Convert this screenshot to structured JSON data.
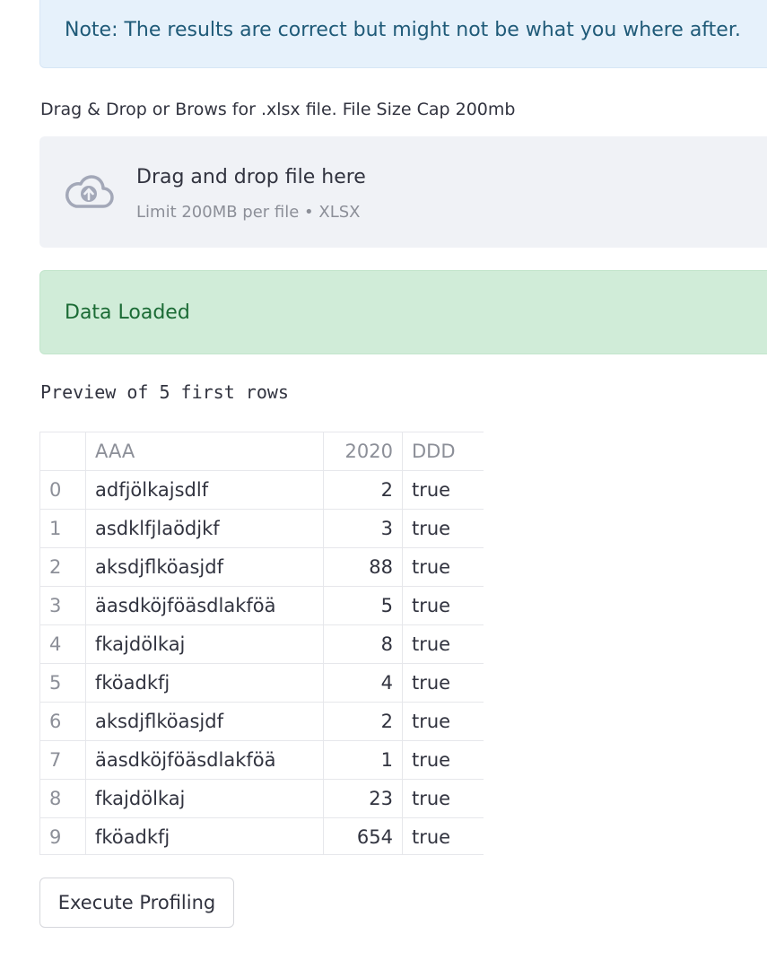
{
  "info": {
    "text": "Note: The results are correct but might not be what you where after."
  },
  "uploader": {
    "label": "Drag & Drop or Brows for .xlsx file. File Size Cap 200mb",
    "icon": "cloud-upload-icon",
    "title": "Drag and drop file here",
    "subtitle": "Limit 200MB per file • XLSX"
  },
  "success": {
    "text": "Data Loaded"
  },
  "preview": {
    "caption": "Preview of 5 first rows",
    "columns": [
      "",
      "AAA",
      "2020",
      "DDD"
    ],
    "rows": [
      [
        "0",
        "adfjölkajsdlf",
        "2",
        "true"
      ],
      [
        "1",
        "asdklfjlaödjkf",
        "3",
        "true"
      ],
      [
        "2",
        "aksdjflköasjdf",
        "88",
        "true"
      ],
      [
        "3",
        "äasdköjföäsdlakföä",
        "5",
        "true"
      ],
      [
        "4",
        "fkajdölkaj",
        "8",
        "true"
      ],
      [
        "5",
        "fköadkfj",
        "4",
        "true"
      ],
      [
        "6",
        "aksdjflköasjdf",
        "2",
        "true"
      ],
      [
        "7",
        "äasdköjföäsdlakföä",
        "1",
        "true"
      ],
      [
        "8",
        "fkajdölkaj",
        "23",
        "true"
      ],
      [
        "9",
        "fköadkfj",
        "654",
        "true"
      ]
    ]
  },
  "actions": {
    "execute_label": "Execute Profiling"
  }
}
